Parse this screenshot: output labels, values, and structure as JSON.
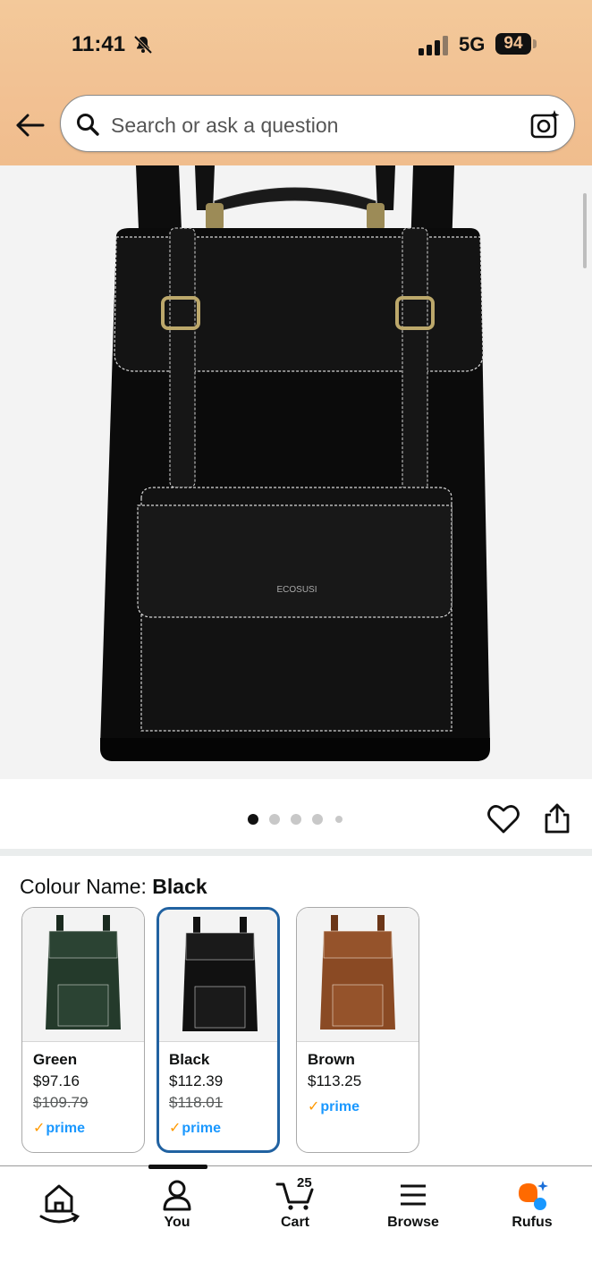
{
  "status_bar": {
    "time": "11:41",
    "network": "5G",
    "battery": "94"
  },
  "search": {
    "placeholder": "Search or ask a question"
  },
  "product": {
    "image_alt": "Black leather backpack",
    "brand_mark": "ECOSUSI",
    "carousel": {
      "total": 5,
      "active": 1
    }
  },
  "colour": {
    "label": "Colour Name:",
    "selected": "Black"
  },
  "variants": [
    {
      "name": "Green",
      "price": "$97.16",
      "was": "$109.79",
      "prime": "prime",
      "color": "#243a2b",
      "selected": false
    },
    {
      "name": "Black",
      "price": "$112.39",
      "was": "$118.01",
      "prime": "prime",
      "color": "#111111",
      "selected": true
    },
    {
      "name": "Brown",
      "price": "$113.25",
      "was": "",
      "prime": "prime",
      "color": "#8a4a24",
      "selected": false
    }
  ],
  "nav": {
    "home": "",
    "you": "You",
    "cart": "Cart",
    "cart_count": "25",
    "browse": "Browse",
    "rufus": "Rufus"
  },
  "colors": {
    "header": "#f2c193",
    "selected_border": "#2162a1",
    "prime_blue": "#1a98ff",
    "prime_check": "#ff9900"
  }
}
